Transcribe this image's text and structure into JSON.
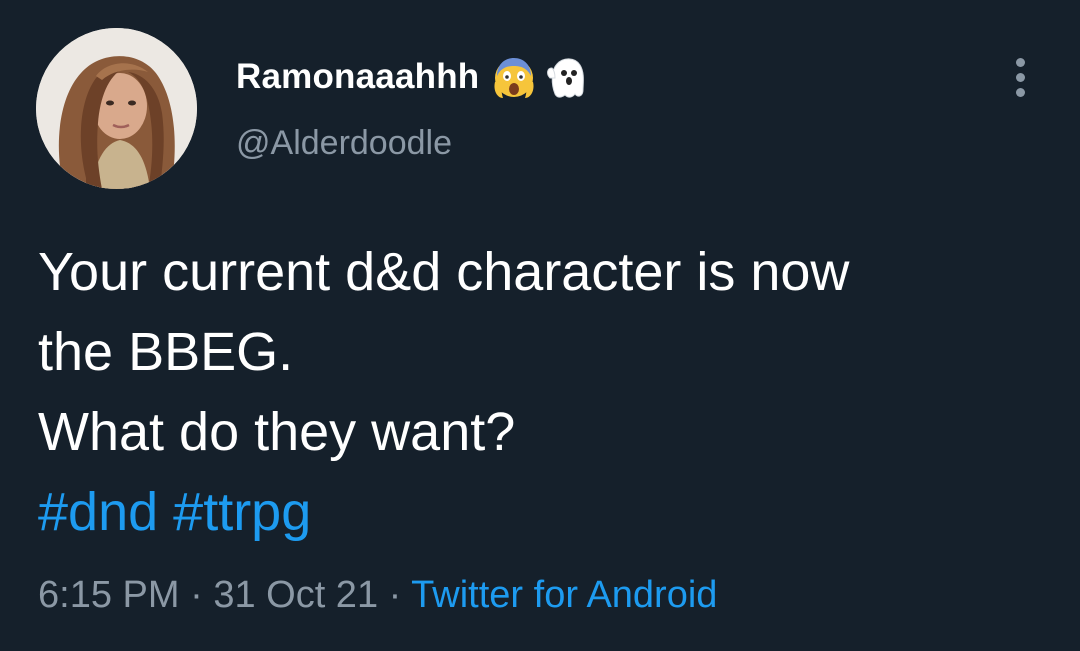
{
  "tweet": {
    "author": {
      "display_name": "Ramonaaahhh",
      "emojis": [
        "screaming-face-icon",
        "ghost-icon"
      ],
      "handle": "@Alderdoodle"
    },
    "text_lines": [
      "Your current d&d character is now",
      "the BBEG.",
      "What do they want?"
    ],
    "hashtags": [
      "#dnd",
      "#ttrpg"
    ],
    "meta": {
      "time": "6:15 PM",
      "separator": "·",
      "date": "31 Oct 21",
      "source": "Twitter for Android"
    }
  },
  "colors": {
    "background": "#15202b",
    "text_primary": "#ffffff",
    "text_secondary": "#8b98a5",
    "accent": "#1d9bf0"
  }
}
